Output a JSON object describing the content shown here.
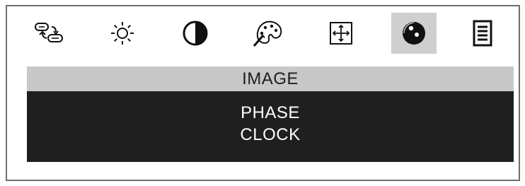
{
  "toolbar": {
    "icons": [
      "input-source-icon",
      "brightness-icon",
      "contrast-icon",
      "color-palette-icon",
      "position-icon",
      "image-setup-icon",
      "menu-icon"
    ],
    "active_icon": "image-setup-icon"
  },
  "panel": {
    "title": "IMAGE",
    "items": [
      "PHASE",
      "CLOCK"
    ]
  },
  "colors": {
    "title_bar": "#c8c8c8",
    "panel_bg": "#1f1f1f",
    "active_icon_bg": "#cfcfcf",
    "text_light": "#ffffff"
  }
}
